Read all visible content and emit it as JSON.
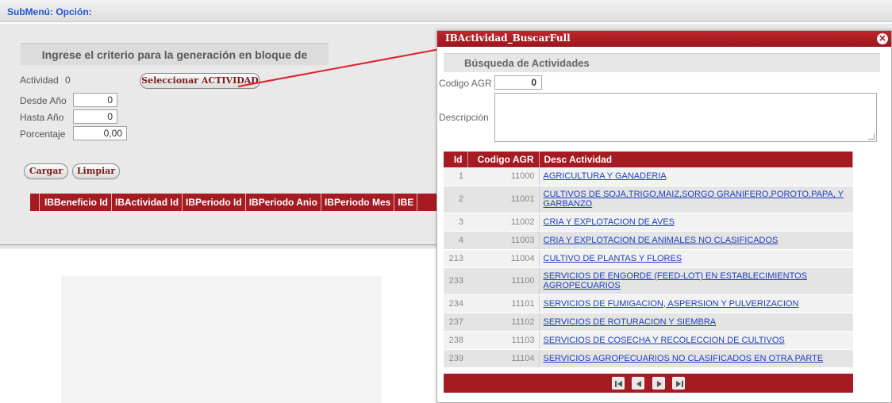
{
  "submenu": {
    "label": "SubMenú: Opción:"
  },
  "form": {
    "criteria_title": "Ingrese el criterio para la generación en bloque de periodos",
    "actividad_label": "Actividad",
    "actividad_value": "0",
    "select_button": "Seleccionar ACTIVIDAD",
    "desde_label": "Desde Año",
    "desde_value": "0",
    "hasta_label": "Hasta Año",
    "hasta_value": "0",
    "porcentaje_label": "Porcentaje",
    "porcentaje_value": "0,00",
    "cargar_button": "Cargar",
    "limpiar_button": "Limpiar"
  },
  "grid_headers": [
    "IBBeneficio Id",
    "IBActividad Id",
    "IBPeriodo Id",
    "IBPeriodo Anio",
    "IBPeriodo Mes",
    "IBE"
  ],
  "modal": {
    "title": "IBActividad_BuscarFull",
    "subtitle": "Búsqueda de Actividades",
    "codigo_label": "Codigo AGR",
    "codigo_value": "0",
    "descripcion_label": "Descripción",
    "columns": {
      "id": "Id",
      "code": "Codigo AGR",
      "desc": "Desc Actividad"
    },
    "rows": [
      {
        "id": "1",
        "code": "11000",
        "desc": "AGRICULTURA Y GANADERIA"
      },
      {
        "id": "2",
        "code": "11001",
        "desc": "CULTIVOS DE SOJA,TRIGO,MAIZ,SORGO GRANIFERO,POROTO,PAPA, Y GARBANZO"
      },
      {
        "id": "3",
        "code": "11002",
        "desc": "CRIA Y EXPLOTACION DE AVES"
      },
      {
        "id": "4",
        "code": "11003",
        "desc": "CRIA Y EXPLOTACION DE ANIMALES NO CLASIFICADOS"
      },
      {
        "id": "213",
        "code": "11004",
        "desc": "CULTIVO DE PLANTAS Y FLORES"
      },
      {
        "id": "233",
        "code": "11100",
        "desc": "SERVICIOS DE ENGORDE (FEED-LOT) EN ESTABLECIMIENTOS AGROPECUARIOS"
      },
      {
        "id": "234",
        "code": "11101",
        "desc": "SERVICIOS DE FUMIGACION, ASPERSION Y PULVERIZACION"
      },
      {
        "id": "237",
        "code": "11102",
        "desc": "SERVICIOS DE ROTURACION Y SIEMBRA"
      },
      {
        "id": "238",
        "code": "11103",
        "desc": "SERVICIOS DE COSECHA Y RECOLECCION DE CULTIVOS"
      },
      {
        "id": "239",
        "code": "11104",
        "desc": "SERVICIOS AGROPECUARIOS NO CLASIFICADOS EN OTRA PARTE"
      }
    ],
    "pager_icons": [
      "first-page-icon",
      "previous-page-icon",
      "next-page-icon",
      "last-page-icon"
    ]
  },
  "colors": {
    "accent": "#a61b22",
    "link": "#1f3fbf",
    "annotation_line": "#e0202a"
  }
}
